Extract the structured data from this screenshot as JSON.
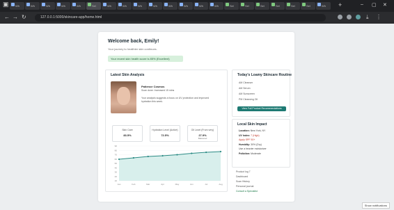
{
  "browser": {
    "tabs": [
      "Wh",
      "Wh",
      "Wh",
      "Wh",
      "Wh",
      "Sel",
      "Wh",
      "Wh",
      "Wh",
      "Wh",
      "Wh",
      "Wh",
      "Wh",
      "Wh",
      "Sel",
      "Sel",
      "Sel",
      "Sel",
      "Sel",
      "Sel",
      "Wh"
    ],
    "new_tab": "+",
    "url": "127.0.0.1:5000/skincare-app/home.html",
    "minimize": "–",
    "maximize": "▢",
    "close": "✕",
    "status_pill": "Show notifications"
  },
  "page": {
    "title": "Welcome back, Emily!",
    "subtitle": "Your journey to healthier skin continues.",
    "banner": "Your recent skin health score is 85% (Excellent)"
  },
  "analysis": {
    "title": "Latest Skin Analysis",
    "name": "Patience Cosmos",
    "meta": "Scan done: Increased 15 mins",
    "notes": [
      "Your analysis suggests a focus on UV protection and improved",
      "hydration this week."
    ],
    "metrics": [
      {
        "label": "Skin Care",
        "value": "83.5%",
        "sub": ""
      },
      {
        "label": "Hydration Level (Active)",
        "value": "72.5%",
        "sub": ""
      },
      {
        "label": "Oil Level (From very)",
        "value": "27.9%",
        "sub": "Balanced"
      }
    ]
  },
  "chart_data": {
    "type": "area",
    "categories": [
      "Jan",
      "Feb",
      "Mar",
      "Apr",
      "May",
      "Jun",
      "Jul",
      "Aug"
    ],
    "values": [
      62,
      66,
      70,
      72,
      75,
      79,
      82,
      84
    ],
    "yticks": [
      "90",
      "80",
      "70",
      "60",
      "50",
      "40",
      "30",
      "20",
      "10"
    ],
    "ylim": [
      0,
      100
    ],
    "grid": true,
    "colors": {
      "line": "#2a8a84",
      "fill": "#d8efec"
    }
  },
  "routine": {
    "title": "Today's Loamy Skincare Routine",
    "items": [
      "AM Cleanser",
      "AM Serum",
      "AM Sunscreen",
      "PM Cleansing Oil"
    ],
    "button": "View Full Product Recommendations"
  },
  "impact": {
    "title": "Local Skin Impact",
    "lines": [
      {
        "key": "Location:",
        "val": "New York, NY",
        "red": false
      },
      {
        "key": "UV Index:",
        "val": "7 (High)",
        "red": true
      },
      {
        "key": "",
        "val": "Apply SPF 50+",
        "red": true
      },
      {
        "key": "Humidity:",
        "val": "30% (Dry)",
        "red": false
      },
      {
        "key": "",
        "val": "Use a heavier moisturizer",
        "red": false
      },
      {
        "key": "Pollution:",
        "val": "Moderate",
        "red": false
      }
    ]
  },
  "links": [
    {
      "text": "Product log 7",
      "green": false
    },
    {
      "text": "Dashboard",
      "green": false
    },
    {
      "text": "Scan History",
      "green": false
    },
    {
      "text": "Personal journal",
      "green": false
    },
    {
      "text": "Consult a Specialist",
      "green": true
    }
  ]
}
